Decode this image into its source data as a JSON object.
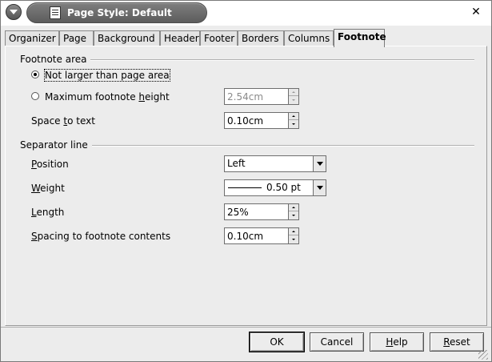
{
  "window": {
    "title": "Page Style: Default"
  },
  "tabs": [
    {
      "label": "Organizer"
    },
    {
      "label": "Page"
    },
    {
      "label": "Background"
    },
    {
      "label": "Header"
    },
    {
      "label": "Footer"
    },
    {
      "label": "Borders"
    },
    {
      "label": "Columns"
    },
    {
      "label": "Footnote"
    }
  ],
  "active_tab": "Footnote",
  "footnote_area": {
    "title": "Footnote area",
    "option_not_larger": {
      "label": "Not larger than page area",
      "selected": true
    },
    "option_max_height": {
      "label_pre": "Maximum footnote ",
      "label_u": "h",
      "label_post": "eight",
      "selected": false,
      "value": "2.54cm",
      "disabled": true
    },
    "space_to_text": {
      "label_pre": "Space ",
      "label_u": "t",
      "label_post": "o text",
      "value": "0.10cm"
    }
  },
  "separator_line": {
    "title": "Separator line",
    "position": {
      "label_u": "P",
      "label_post": "osition",
      "value": "Left"
    },
    "weight": {
      "label_u": "W",
      "label_post": "eight",
      "value": "0.50 pt"
    },
    "length": {
      "label_u": "L",
      "label_post": "ength",
      "value": "25%"
    },
    "spacing": {
      "label_u": "S",
      "label_post": "pacing to footnote contents",
      "value": "0.10cm"
    }
  },
  "buttons": {
    "ok": "OK",
    "cancel": "Cancel",
    "help_u": "H",
    "help_post": "elp",
    "reset_u": "R",
    "reset_post": "eset"
  }
}
